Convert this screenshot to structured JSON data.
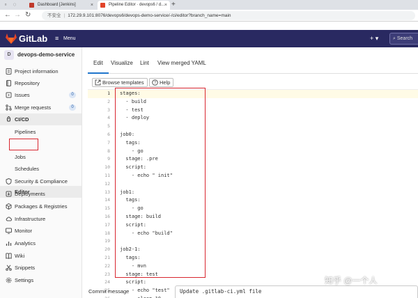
{
  "browser": {
    "tabs": [
      {
        "title": "Dashboard [Jenkins]",
        "favicon_color": "#c0392b"
      },
      {
        "title": "Pipeline Editor · devops6 / d...",
        "favicon_color": "#e24329"
      }
    ],
    "insecure_label": "不安全",
    "url": "172.29.9.101:8076/devops6/devops-demo-service/-/ci/editor?branch_name=main"
  },
  "header": {
    "brand": "GitLab",
    "menu_label": "Menu",
    "plus_label": "+ ▾",
    "search_placeholder": "Search"
  },
  "sidebar": {
    "project_avatar": "D",
    "project_name": "devops-demo-service",
    "items": [
      {
        "label": "Project information"
      },
      {
        "label": "Repository"
      },
      {
        "label": "Issues",
        "count": "0"
      },
      {
        "label": "Merge requests",
        "count": "0"
      },
      {
        "label": "CI/CD"
      },
      {
        "label": "Pipelines"
      },
      {
        "label": "Editor"
      },
      {
        "label": "Jobs"
      },
      {
        "label": "Schedules"
      },
      {
        "label": "Security & Compliance"
      },
      {
        "label": "Deployments"
      },
      {
        "label": "Packages & Registries"
      },
      {
        "label": "Infrastructure"
      },
      {
        "label": "Monitor"
      },
      {
        "label": "Analytics"
      },
      {
        "label": "Wiki"
      },
      {
        "label": "Snippets"
      },
      {
        "label": "Settings"
      }
    ]
  },
  "editor": {
    "tabs": [
      "Edit",
      "Visualize",
      "Lint",
      "View merged YAML"
    ],
    "browse_templates": "Browse templates",
    "help": "Help",
    "lines": [
      "stages:",
      "  - build",
      "  - test",
      "  - deploy",
      "",
      "job0:",
      "  tags:",
      "    - go",
      "  stage: .pre",
      "  script:",
      "    - echo \" init\"",
      "",
      "job1:",
      "  tags:",
      "    - go",
      "  stage: build",
      "  script:",
      "    - echo \"build\"",
      "",
      "job2-1:",
      "  tags:",
      "    - mvn",
      "  stage: test",
      "  script:",
      "    - echo \"test\"",
      "    - sleep 10"
    ],
    "line_numbers": [
      "1",
      "2",
      "3",
      "4",
      "5",
      "6",
      "7",
      "8",
      "9",
      "10",
      "11",
      "12",
      "13",
      "14",
      "15",
      "16",
      "17",
      "18",
      "19",
      "20",
      "21",
      "22",
      "23",
      "24",
      "25",
      "26"
    ],
    "commit_label": "Commit message",
    "commit_value": "Update .gitlab-ci.yml file"
  },
  "watermark": "知乎 @一个人",
  "colors": {
    "header_bg": "#292961",
    "accent": "#1f75cb",
    "highlight": "#d8262f"
  }
}
